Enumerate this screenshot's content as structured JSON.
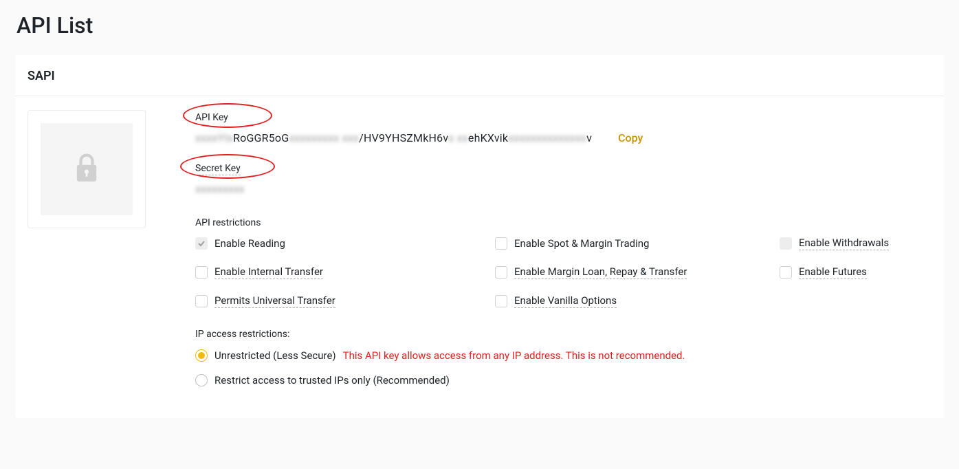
{
  "page_title": "API List",
  "card_title": "SAPI",
  "api_key": {
    "label": "API Key",
    "value_prefix_blur": "xxxxYIx",
    "value_seg1": "RoGGR5oG",
    "value_mid_blur": "xxxxxxxxx  xxx",
    "value_seg2": "/HV9YHSZMkH6v",
    "value_mid2_blur": "x   xx",
    "value_seg3": "ehKXvik",
    "value_end_blur": "xxxxxxxxxxxxxx",
    "value_seg4": "v",
    "copy": "Copy"
  },
  "secret_key": {
    "label": "Secret Key",
    "value_blur": "xxxxxxxxx"
  },
  "restrictions": {
    "label": "API restrictions",
    "items": {
      "reading": {
        "label": "Enable Reading",
        "checked": true,
        "underline": false
      },
      "spot_margin": {
        "label": "Enable Spot & Margin Trading",
        "checked": false,
        "underline": false
      },
      "withdrawals": {
        "label": "Enable Withdrawals",
        "checked": false,
        "underline": true,
        "disabled_fill": true
      },
      "internal": {
        "label": "Enable Internal Transfer",
        "checked": false,
        "underline": true
      },
      "margin_loan": {
        "label": "Enable Margin Loan, Repay & Transfer",
        "checked": false,
        "underline": true
      },
      "futures": {
        "label": "Enable Futures",
        "checked": false,
        "underline": true
      },
      "universal": {
        "label": "Permits Universal Transfer",
        "checked": false,
        "underline": true
      },
      "vanilla": {
        "label": "Enable Vanilla Options",
        "checked": false,
        "underline": true
      }
    }
  },
  "ip": {
    "label": "IP access restrictions:",
    "unrestricted": {
      "label": "Unrestricted (Less Secure)",
      "warning": "This API key allows access from any IP address. This is not recommended.",
      "selected": true
    },
    "restricted": {
      "label": "Restrict access to trusted IPs only (Recommended)",
      "selected": false
    }
  }
}
